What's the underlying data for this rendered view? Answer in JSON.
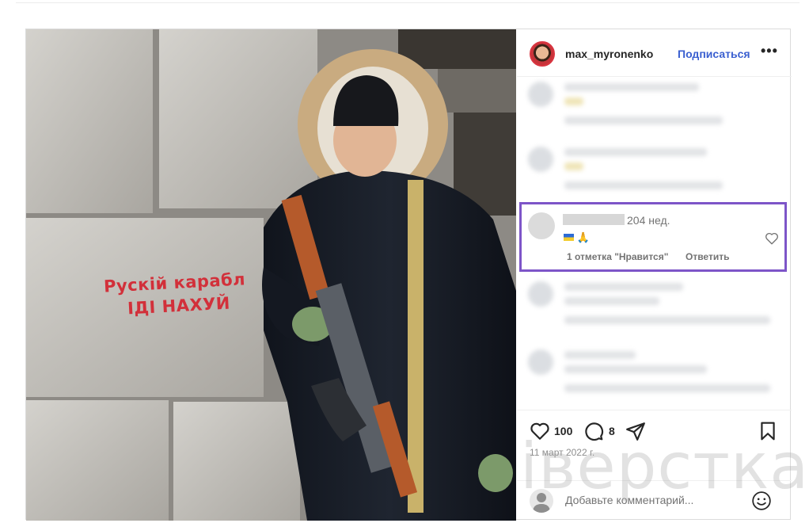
{
  "post": {
    "username": "max_myronenko",
    "follow_label": "Подписаться",
    "more_label": "•••",
    "photo": {
      "wall_text_line1": "Рускій карабл",
      "wall_text_line2": "ІДІ НАХУЙ"
    }
  },
  "highlighted_comment": {
    "time": "204 нед.",
    "likes_label": "1 отметка \"Нравится\"",
    "reply_label": "Ответить"
  },
  "actions": {
    "like_count": "100",
    "comment_count": "8",
    "date": "11 март 2022 г."
  },
  "comment_box": {
    "placeholder": "Добавьте комментарий..."
  },
  "watermark": "іверстка",
  "colors": {
    "follow_blue": "#3a5fd0",
    "highlight_purple": "#7d55c8",
    "wall_text_red": "#d2303a"
  }
}
